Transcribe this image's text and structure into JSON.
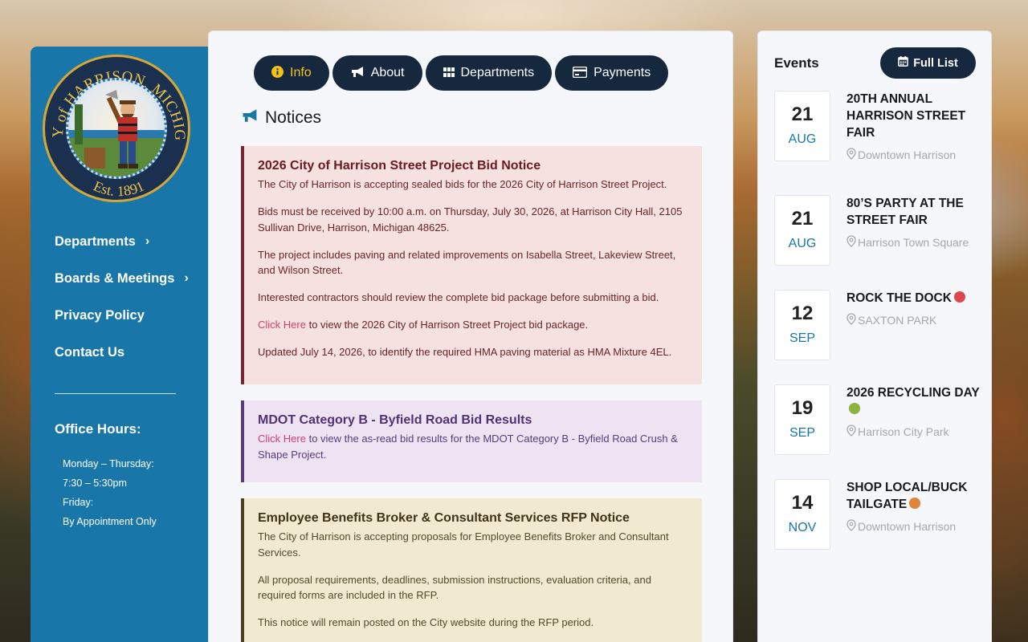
{
  "sidebar": {
    "seal": {
      "top_text": "CITY of HARRISON, MICHIGAN",
      "bottom_text": "Est. 1891"
    },
    "items": [
      {
        "label": "Departments",
        "has_chevron": true
      },
      {
        "label": "Boards & Meetings",
        "has_chevron": true
      },
      {
        "label": "Privacy Policy",
        "has_chevron": false
      },
      {
        "label": "Contact Us",
        "has_chevron": false
      }
    ],
    "office_hours_title": "Office Hours:",
    "office_hours": [
      "Monday – Thursday:",
      "7:30 – 5:30pm",
      "Friday:",
      "By Appointment Only"
    ]
  },
  "tabs": [
    {
      "label": "Info",
      "icon": "info-circle-icon",
      "active": true
    },
    {
      "label": "About",
      "icon": "megaphone-icon",
      "active": false
    },
    {
      "label": "Departments",
      "icon": "grid-icon",
      "active": false
    },
    {
      "label": "Payments",
      "icon": "credit-card-icon",
      "active": false
    }
  ],
  "notices": {
    "title": "Notices",
    "items": [
      {
        "title": "2026 City of Harrison Street Project Bid Notice",
        "p1": "The City of Harrison is accepting sealed bids for the 2026 City of Harrison Street Project.",
        "p2": "Bids must be received by 10:00 a.m. on Thursday, July 30, 2026, at Harrison City Hall, 2105 Sullivan Drive, Harrison, Michigan 48625.",
        "p3": "The project includes paving and related improvements on Isabella Street, Lakeview Street, and Wilson Street.",
        "p4": "Interested contractors should review the complete bid package before submitting a bid.",
        "link": "Click Here",
        "p5_after": " to view the 2026 City of Harrison Street Project bid package.",
        "p6": "Updated July 14, 2026, to identify the required HMA paving material as HMA Mixture 4EL."
      },
      {
        "title": "MDOT Category B - Byfield Road Bid Results",
        "link": "Click Here",
        "p1_after": " to view the as-read bid results for the MDOT Category B - Byfield Road Crush & Shape Project."
      },
      {
        "title": "Employee Benefits Broker & Consultant Services RFP Notice",
        "p1": "The City of Harrison is accepting proposals for Employee Benefits Broker and Consultant Services.",
        "p2": "All proposal requirements, deadlines, submission instructions, evaluation criteria, and required forms are included in the RFP.",
        "p3": "This notice will remain posted on the City website during the RFP period."
      }
    ]
  },
  "events": {
    "title": "Events",
    "full_list_label": "Full List",
    "items": [
      {
        "day": "21",
        "month": "AUG",
        "title": "20th Annual Harrison Street Fair",
        "location": "Downtown Harrison",
        "dot_color": ""
      },
      {
        "day": "21",
        "month": "AUG",
        "title": "80’s Party at the Street Fair",
        "location": "Harrison Town Square",
        "dot_color": ""
      },
      {
        "day": "12",
        "month": "SEP",
        "title": "Rock the Dock",
        "location": "SAXTON PARK",
        "dot_color": "#e0474c"
      },
      {
        "day": "19",
        "month": "SEP",
        "title": "2026 Recycling Day",
        "location": "Harrison City Park",
        "dot_color": "#8ab43c"
      },
      {
        "day": "14",
        "month": "NOV",
        "title": "Shop Local/Buck Tailgate",
        "location": "Downtown Harrison",
        "dot_color": "#e0843c"
      }
    ]
  }
}
